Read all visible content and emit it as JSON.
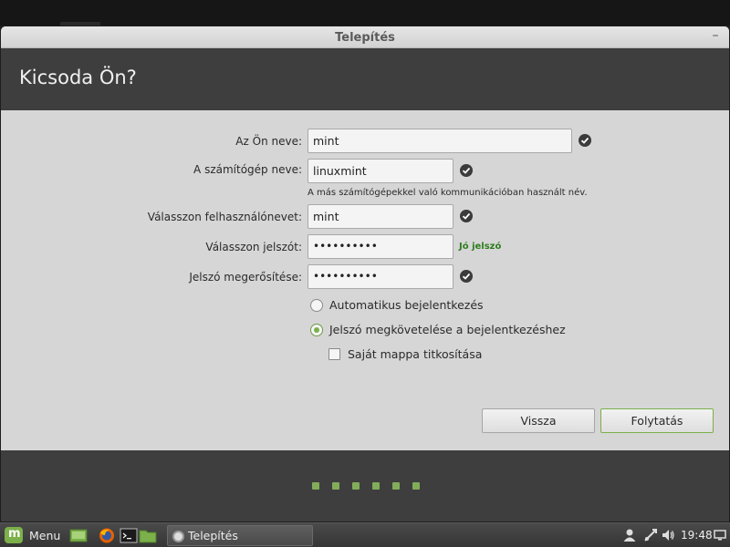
{
  "window": {
    "title": "Telepítés"
  },
  "page": {
    "heading": "Kicsoda Ön?"
  },
  "form": {
    "name_label": "Az Ön neve:",
    "name_value": "mint",
    "computer_label": "A számítógép neve:",
    "computer_value": "linuxmint",
    "computer_hint": "A más számítógépekkel való kommunikációban használt név.",
    "username_label": "Válasszon felhasználónevet:",
    "username_value": "mint",
    "password_label": "Válasszon jelszót:",
    "password_value": "••••••••••",
    "password_strength": "Jó jelszó",
    "confirm_label": "Jelszó megerősítése:",
    "confirm_value": "••••••••••"
  },
  "options": {
    "auto_login": {
      "label": "Automatikus bejelentkezés",
      "selected": false
    },
    "require_password": {
      "label": "Jelszó megkövetelése a bejelentkezéshez",
      "selected": true
    },
    "encrypt_home": {
      "label": "Saját mappa titkosítása",
      "checked": false
    }
  },
  "buttons": {
    "back": "Vissza",
    "continue": "Folytatás"
  },
  "progress": {
    "total_steps": 6
  },
  "taskbar": {
    "menu_label": "Menu",
    "window_label": "Telepítés",
    "clock": "19:48",
    "launchers": [
      "show-desktop-icon",
      "firefox-icon",
      "terminal-icon",
      "files-icon"
    ],
    "tray": [
      "user-icon",
      "network-icon",
      "volume-icon",
      "display-icon"
    ]
  },
  "colors": {
    "accent": "#7bb04a",
    "header": "#3e3e3e",
    "strength": "#2e7d1f"
  }
}
